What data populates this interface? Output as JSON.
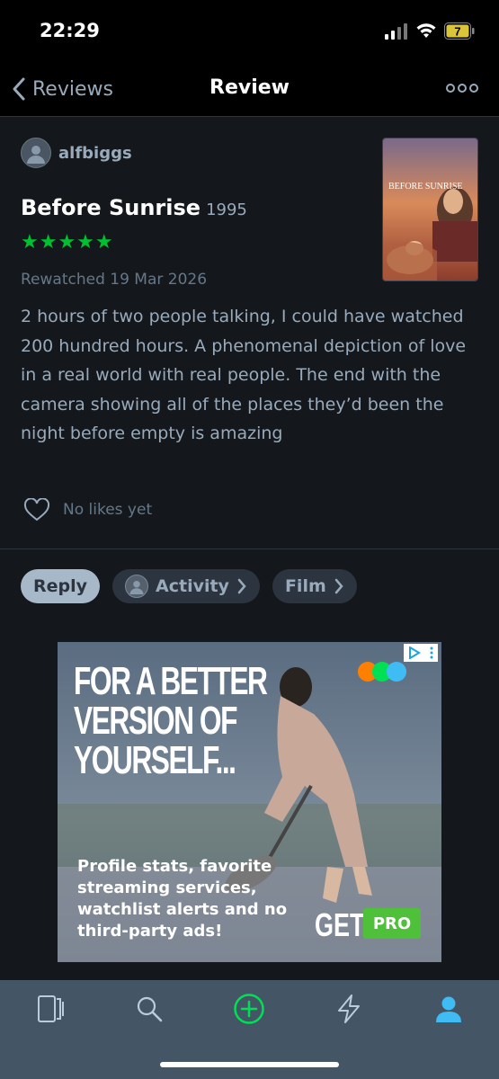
{
  "status_bar": {
    "time": "22:29",
    "battery": "7"
  },
  "nav": {
    "back_label": "Reviews",
    "title": "Review"
  },
  "review": {
    "author": "alfbiggs",
    "film_title": "Before Sunrise",
    "film_year": "1995",
    "rating_stars": "★★★★★",
    "rewatched": "Rewatched 19 Mar 2026",
    "text": "2 hours of two people talking, I could have watched 200 hundred hours. A phenomenal depiction of love in a real world with real people. The end with the camera showing all of the places they’d been the night before empty is amazing",
    "likes": "No likes yet",
    "poster_text": "BEFORE SUNRISE"
  },
  "actions": {
    "reply": "Reply",
    "activity": "Activity",
    "film": "Film"
  },
  "ad": {
    "headline": "FOR A BETTER VERSION OF YOURSELF...",
    "body": "Profile stats, favorite streaming services, watchlist alerts and no third-party ads!",
    "get": "GET",
    "pro": "PRO"
  },
  "colors": {
    "accent_green": "#00c030",
    "background": "#14181c",
    "tab_bar": "#445566",
    "active_tab": "#40bcf4"
  },
  "tab_bar": {
    "icons": [
      "films-icon",
      "search-icon",
      "add-icon",
      "activity-icon",
      "profile-icon"
    ],
    "active": "profile-icon"
  }
}
